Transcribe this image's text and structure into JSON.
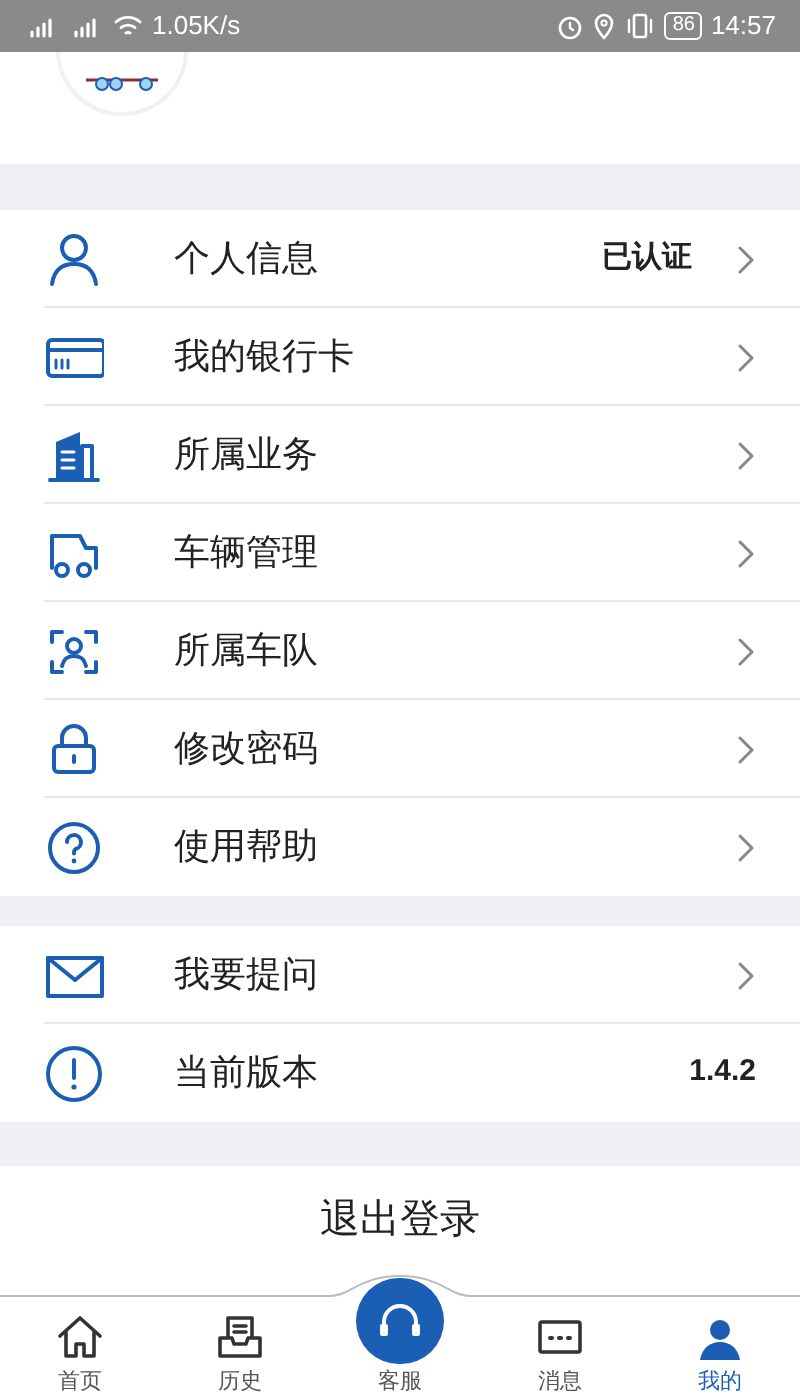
{
  "status_bar": {
    "left_text": "1.05K/s",
    "battery": "86",
    "time": "14:57"
  },
  "menu_groups": [
    {
      "items": [
        {
          "label": "个人信息",
          "value": "已认证",
          "arrow": true
        },
        {
          "label": "我的银行卡",
          "arrow": true
        },
        {
          "label": "所属业务",
          "arrow": true
        },
        {
          "label": "车辆管理",
          "arrow": true
        },
        {
          "label": "所属车队",
          "arrow": true
        },
        {
          "label": "修改密码",
          "arrow": true
        },
        {
          "label": "使用帮助",
          "arrow": true
        }
      ]
    },
    {
      "items": [
        {
          "label": "我要提问",
          "arrow": true
        },
        {
          "label": "当前版本",
          "value": "1.4.2",
          "arrow": false
        }
      ]
    }
  ],
  "logout_button": "退出登录",
  "tab_bar": [
    {
      "label": "首页",
      "selected": false,
      "kind": "tab"
    },
    {
      "label": "历史",
      "selected": false,
      "kind": "tab"
    },
    {
      "label": "客服",
      "selected": false,
      "kind": "center"
    },
    {
      "label": "消息",
      "selected": false,
      "kind": "tab"
    },
    {
      "label": "我的",
      "selected": true,
      "kind": "tab"
    }
  ]
}
